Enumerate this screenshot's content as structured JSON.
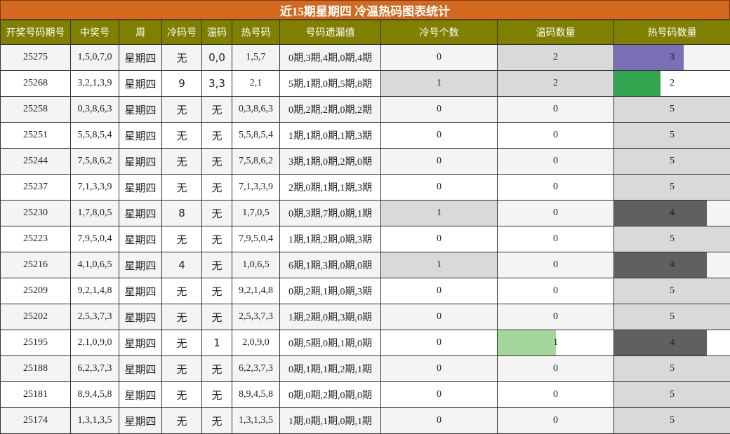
{
  "title": "近15期星期四 冷温热码图表统计",
  "headers": [
    "开奖号码期号",
    "中奖号",
    "周",
    "冷码号",
    "温码",
    "热号码",
    "号码遗漏值",
    "冷号个数",
    "温码数量",
    "热号码数量"
  ],
  "colors": {
    "title_bg": "#d2691e",
    "header_bg": "#808000",
    "highlight_gray": "#d9d9d9",
    "bar_purple": "#7b6fb8",
    "bar_green": "#33a652",
    "bar_light_green": "#a4d89a",
    "bar_dark_gray": "#606060"
  },
  "rows": [
    {
      "period": "25275",
      "numbers": "1,5,0,7,0",
      "week": "星期四",
      "cold": "无",
      "warm": "0,0",
      "hot": "1,5,7",
      "missing": "0期,3期,4期,0期,4期",
      "cold_count": "0",
      "warm_count": "2",
      "hot_count": "3",
      "cold_hl": false,
      "warm_hl": true,
      "cold_frac": 0,
      "warm_frac": 1,
      "warm_bar_color": "#d9d9d9",
      "hot_frac": 0.6,
      "hot_bar_color": "#7b6fb8"
    },
    {
      "period": "25268",
      "numbers": "3,2,1,3,9",
      "week": "星期四",
      "cold": "9",
      "warm": "3,3",
      "hot": "2,1",
      "missing": "5期,1期,0期,5期,8期",
      "cold_count": "1",
      "warm_count": "2",
      "hot_count": "2",
      "cold_hl": true,
      "warm_hl": true,
      "cold_frac": 1,
      "warm_frac": 1,
      "warm_bar_color": "#d9d9d9",
      "hot_frac": 0.4,
      "hot_bar_color": "#33a652"
    },
    {
      "period": "25258",
      "numbers": "0,3,8,6,3",
      "week": "星期四",
      "cold": "无",
      "warm": "无",
      "hot": "0,3,8,6,3",
      "missing": "0期,2期,2期,0期,2期",
      "cold_count": "0",
      "warm_count": "0",
      "hot_count": "5",
      "cold_hl": false,
      "warm_hl": false,
      "cold_frac": 0,
      "warm_frac": 0,
      "warm_bar_color": "#d9d9d9",
      "hot_frac": 1,
      "hot_bar_color": "#d9d9d9"
    },
    {
      "period": "25251",
      "numbers": "5,5,8,5,4",
      "week": "星期四",
      "cold": "无",
      "warm": "无",
      "hot": "5,5,8,5,4",
      "missing": "1期,1期,0期,1期,3期",
      "cold_count": "0",
      "warm_count": "0",
      "hot_count": "5",
      "cold_hl": false,
      "warm_hl": false,
      "cold_frac": 0,
      "warm_frac": 0,
      "warm_bar_color": "#d9d9d9",
      "hot_frac": 1,
      "hot_bar_color": "#d9d9d9"
    },
    {
      "period": "25244",
      "numbers": "7,5,8,6,2",
      "week": "星期四",
      "cold": "无",
      "warm": "无",
      "hot": "7,5,8,6,2",
      "missing": "3期,1期,0期,2期,0期",
      "cold_count": "0",
      "warm_count": "0",
      "hot_count": "5",
      "cold_hl": false,
      "warm_hl": false,
      "cold_frac": 0,
      "warm_frac": 0,
      "warm_bar_color": "#d9d9d9",
      "hot_frac": 1,
      "hot_bar_color": "#d9d9d9"
    },
    {
      "period": "25237",
      "numbers": "7,1,3,3,9",
      "week": "星期四",
      "cold": "无",
      "warm": "无",
      "hot": "7,1,3,3,9",
      "missing": "2期,0期,1期,1期,3期",
      "cold_count": "0",
      "warm_count": "0",
      "hot_count": "5",
      "cold_hl": false,
      "warm_hl": false,
      "cold_frac": 0,
      "warm_frac": 0,
      "warm_bar_color": "#d9d9d9",
      "hot_frac": 1,
      "hot_bar_color": "#d9d9d9"
    },
    {
      "period": "25230",
      "numbers": "1,7,8,0,5",
      "week": "星期四",
      "cold": "8",
      "warm": "无",
      "hot": "1,7,0,5",
      "missing": "0期,3期,7期,0期,1期",
      "cold_count": "1",
      "warm_count": "0",
      "hot_count": "4",
      "cold_hl": true,
      "warm_hl": false,
      "cold_frac": 1,
      "warm_frac": 0,
      "warm_bar_color": "#d9d9d9",
      "hot_frac": 0.8,
      "hot_bar_color": "#606060"
    },
    {
      "period": "25223",
      "numbers": "7,9,5,0,4",
      "week": "星期四",
      "cold": "无",
      "warm": "无",
      "hot": "7,9,5,0,4",
      "missing": "1期,1期,2期,0期,3期",
      "cold_count": "0",
      "warm_count": "0",
      "hot_count": "5",
      "cold_hl": false,
      "warm_hl": false,
      "cold_frac": 0,
      "warm_frac": 0,
      "warm_bar_color": "#d9d9d9",
      "hot_frac": 1,
      "hot_bar_color": "#d9d9d9"
    },
    {
      "period": "25216",
      "numbers": "4,1,0,6,5",
      "week": "星期四",
      "cold": "4",
      "warm": "无",
      "hot": "1,0,6,5",
      "missing": "6期,1期,3期,0期,0期",
      "cold_count": "1",
      "warm_count": "0",
      "hot_count": "4",
      "cold_hl": true,
      "warm_hl": false,
      "cold_frac": 1,
      "warm_frac": 0,
      "warm_bar_color": "#d9d9d9",
      "hot_frac": 0.8,
      "hot_bar_color": "#606060"
    },
    {
      "period": "25209",
      "numbers": "9,2,1,4,8",
      "week": "星期四",
      "cold": "无",
      "warm": "无",
      "hot": "9,2,1,4,8",
      "missing": "0期,2期,1期,0期,3期",
      "cold_count": "0",
      "warm_count": "0",
      "hot_count": "5",
      "cold_hl": false,
      "warm_hl": false,
      "cold_frac": 0,
      "warm_frac": 0,
      "warm_bar_color": "#d9d9d9",
      "hot_frac": 1,
      "hot_bar_color": "#d9d9d9"
    },
    {
      "period": "25202",
      "numbers": "2,5,3,7,3",
      "week": "星期四",
      "cold": "无",
      "warm": "无",
      "hot": "2,5,3,7,3",
      "missing": "1期,2期,0期,3期,0期",
      "cold_count": "0",
      "warm_count": "0",
      "hot_count": "5",
      "cold_hl": false,
      "warm_hl": false,
      "cold_frac": 0,
      "warm_frac": 0,
      "warm_bar_color": "#d9d9d9",
      "hot_frac": 1,
      "hot_bar_color": "#d9d9d9"
    },
    {
      "period": "25195",
      "numbers": "2,1,0,9,0",
      "week": "星期四",
      "cold": "无",
      "warm": "1",
      "hot": "2,0,9,0",
      "missing": "0期,5期,0期,1期,0期",
      "cold_count": "0",
      "warm_count": "1",
      "hot_count": "4",
      "cold_hl": false,
      "warm_hl": false,
      "cold_frac": 0,
      "warm_frac": 0.5,
      "warm_bar_color": "#a4d89a",
      "hot_frac": 0.8,
      "hot_bar_color": "#606060"
    },
    {
      "period": "25188",
      "numbers": "6,2,3,7,3",
      "week": "星期四",
      "cold": "无",
      "warm": "无",
      "hot": "6,2,3,7,3",
      "missing": "0期,1期,1期,2期,1期",
      "cold_count": "0",
      "warm_count": "0",
      "hot_count": "5",
      "cold_hl": false,
      "warm_hl": false,
      "cold_frac": 0,
      "warm_frac": 0,
      "warm_bar_color": "#d9d9d9",
      "hot_frac": 1,
      "hot_bar_color": "#d9d9d9"
    },
    {
      "period": "25181",
      "numbers": "8,9,4,5,8",
      "week": "星期四",
      "cold": "无",
      "warm": "无",
      "hot": "8,9,4,5,8",
      "missing": "0期,0期,2期,0期,0期",
      "cold_count": "0",
      "warm_count": "0",
      "hot_count": "5",
      "cold_hl": false,
      "warm_hl": false,
      "cold_frac": 0,
      "warm_frac": 0,
      "warm_bar_color": "#d9d9d9",
      "hot_frac": 1,
      "hot_bar_color": "#d9d9d9"
    },
    {
      "period": "25174",
      "numbers": "1,3,1,3,5",
      "week": "星期四",
      "cold": "无",
      "warm": "无",
      "hot": "1,3,1,3,5",
      "missing": "1期,0期,1期,0期,1期",
      "cold_count": "0",
      "warm_count": "0",
      "hot_count": "5",
      "cold_hl": false,
      "warm_hl": false,
      "cold_frac": 0,
      "warm_frac": 0,
      "warm_bar_color": "#d9d9d9",
      "hot_frac": 1,
      "hot_bar_color": "#d9d9d9"
    }
  ]
}
